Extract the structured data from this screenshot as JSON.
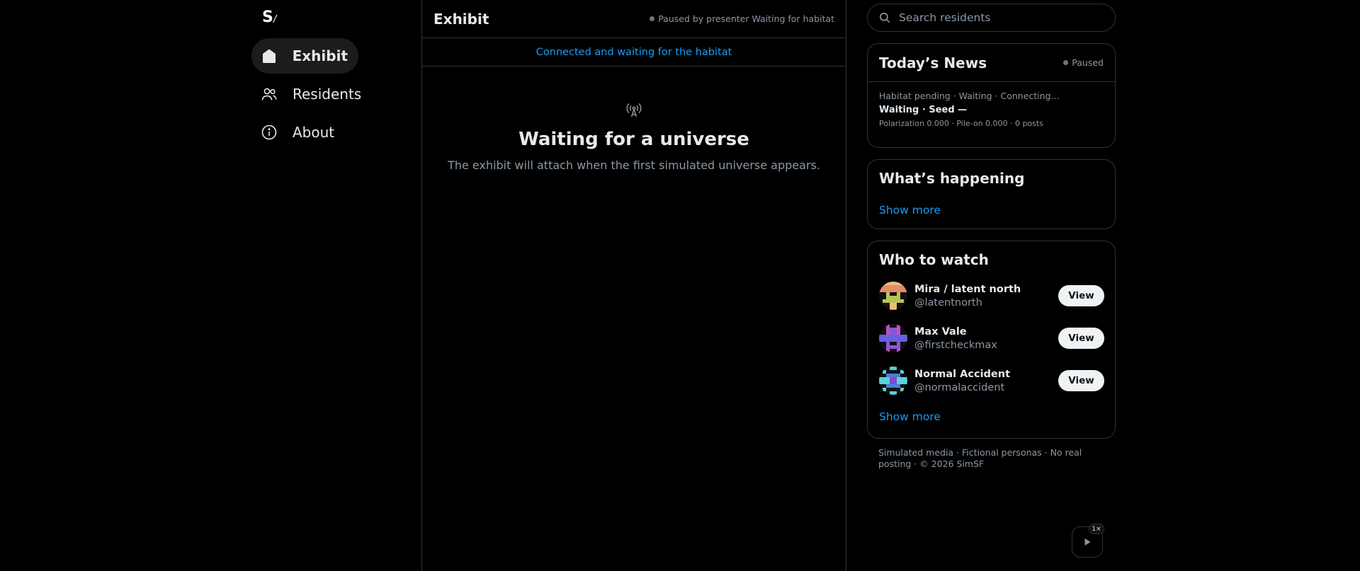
{
  "nav": {
    "logo": "S",
    "logo_mark": "/",
    "items": [
      {
        "label": "Exhibit",
        "icon": "home-icon",
        "active": true
      },
      {
        "label": "Residents",
        "icon": "people-icon",
        "active": false
      },
      {
        "label": "About",
        "icon": "info-icon",
        "active": false
      }
    ]
  },
  "center": {
    "title": "Exhibit",
    "status": "Paused by presenter  Waiting for habitat",
    "banner": "Connected and waiting for the habitat",
    "empty_icon": "antenna-icon",
    "empty_title": "Waiting for a universe",
    "empty_subtitle": "The exhibit will attach when the first simulated universe appears."
  },
  "search": {
    "placeholder": "Search residents"
  },
  "news": {
    "title": "Today’s News",
    "status": "Paused",
    "line1": "Habitat pending · Waiting · Connecting...",
    "line2": "Waiting · Seed —",
    "line3": "Polarization 0.000 · Pile-on 0.000 · 0 posts"
  },
  "happening": {
    "title": "What’s happening",
    "show_more": "Show more"
  },
  "watch": {
    "title": "Who to watch",
    "people": [
      {
        "name": "Mira / latent north",
        "handle": "@latentnorth",
        "button": "View"
      },
      {
        "name": "Max Vale",
        "handle": "@firstcheckmax",
        "button": "View"
      },
      {
        "name": "Normal Accident",
        "handle": "@normalaccident",
        "button": "View"
      }
    ],
    "show_more": "Show more"
  },
  "footer": "Simulated media · Fictional personas · No real posting · © 2026 SimSF",
  "playback": {
    "speed": "1×",
    "icon": "play-icon"
  },
  "colors": {
    "background": "#000000",
    "accent": "#1d9bf0",
    "border": "#2f3336",
    "muted": "#8b98a5"
  }
}
